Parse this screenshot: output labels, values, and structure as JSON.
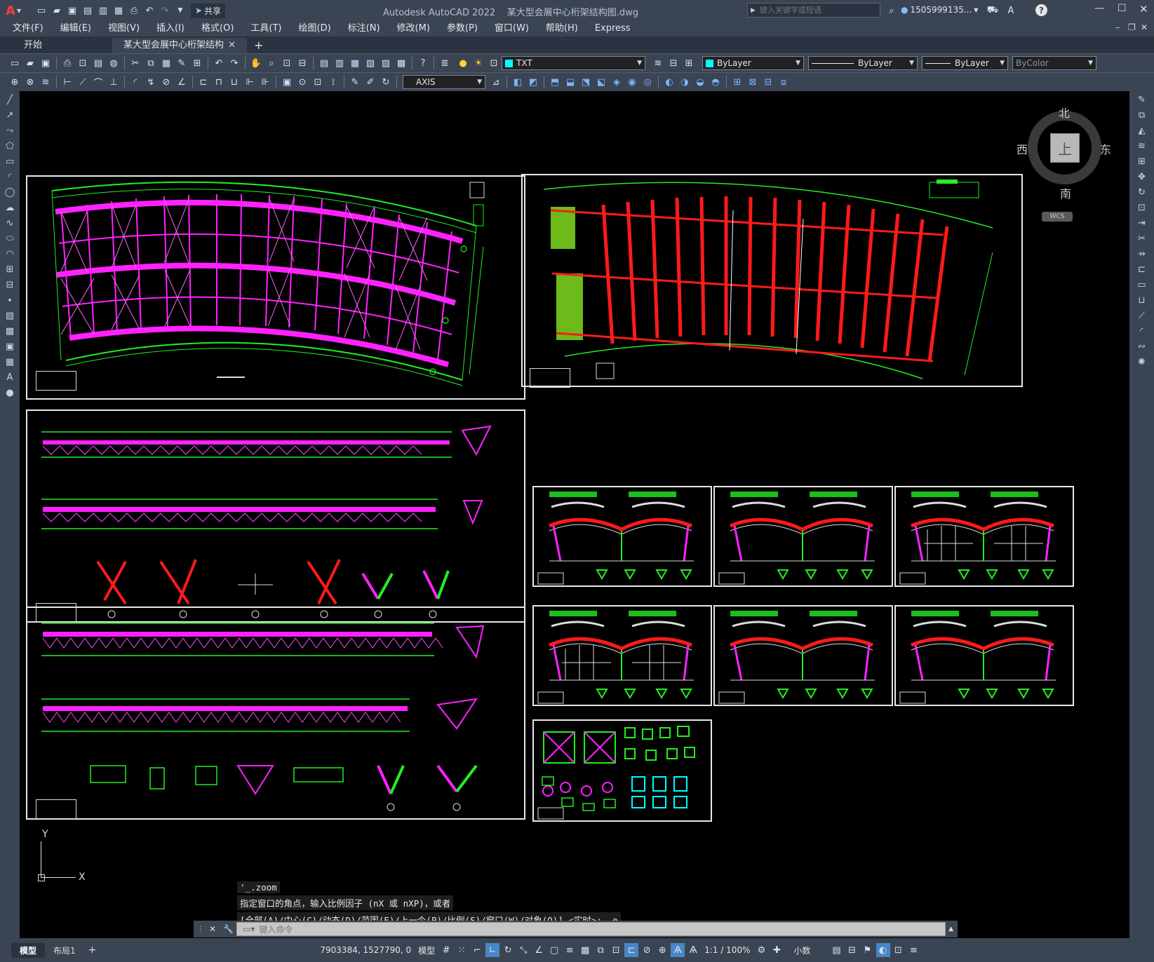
{
  "titlebar": {
    "app_title": "Autodesk AutoCAD 2022",
    "file_name": "某大型会展中心桁架结构图.dwg",
    "share_label": "共享",
    "search_placeholder": "键入关键字或短语",
    "user": "1505999135...",
    "help": "?"
  },
  "menus": [
    "文件(F)",
    "编辑(E)",
    "视图(V)",
    "插入(I)",
    "格式(O)",
    "工具(T)",
    "绘图(D)",
    "标注(N)",
    "修改(M)",
    "参数(P)",
    "窗口(W)",
    "帮助(H)",
    "Express"
  ],
  "tabs": {
    "start": "开始",
    "doc": "某大型会展中心桁架结构图*",
    "plus": "+"
  },
  "toolbar": {
    "layer_value": "TXT",
    "color_value": "ByLayer",
    "linetype_value": "ByLayer",
    "lineweight_value": "ByLayer",
    "plotstyle_value": "ByColor",
    "style_value": "AXIS"
  },
  "viewcube": {
    "north": "北",
    "south": "南",
    "east": "东",
    "west": "西",
    "top": "上",
    "wcs": "WCS"
  },
  "ucs": {
    "y": "Y",
    "x": "X"
  },
  "command": {
    "history": [
      "'_.zoom",
      "指定窗口的角点，输入比例因子 (nX 或 nXP)，或者",
      "[全部(A)/中心(C)/动态(D)/范围(E)/上一个(P)/比例(S)/窗口(W)/对象(O)] <实时>: _e"
    ],
    "placeholder": "键入命令"
  },
  "layout": {
    "model_tab": "模型",
    "layout1_tab": "布局1",
    "plus": "+"
  },
  "status": {
    "coords": "7903384, 1527790, 0",
    "model": "模型",
    "scale": "1:1 / 100%",
    "units": "小数"
  },
  "colors": {
    "ui": "#3b4453",
    "accent": "#ff3030",
    "green": "#22ee22",
    "magenta": "#ff22ff",
    "red": "#ff1a1a"
  }
}
